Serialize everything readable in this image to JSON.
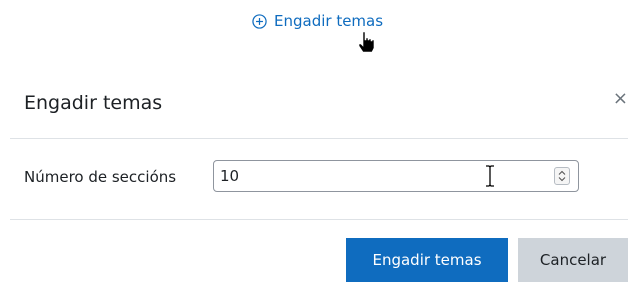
{
  "top_link": {
    "label": "Engadir temas"
  },
  "modal": {
    "title": "Engadir temas",
    "close_glyph": "×",
    "field": {
      "label": "Número de seccións",
      "value": "10"
    },
    "primary_button": "Engadir temas",
    "secondary_button": "Cancelar"
  },
  "icons": {
    "add": "plus-circle-icon",
    "close": "close-icon",
    "spinner": "number-spinner-icon",
    "cursor": "hand-cursor-icon",
    "text_cursor": "ibeam-cursor-icon"
  },
  "colors": {
    "accent": "#0f6cbf",
    "secondary_button_bg": "#ced4da",
    "divider": "#dee2e6"
  }
}
